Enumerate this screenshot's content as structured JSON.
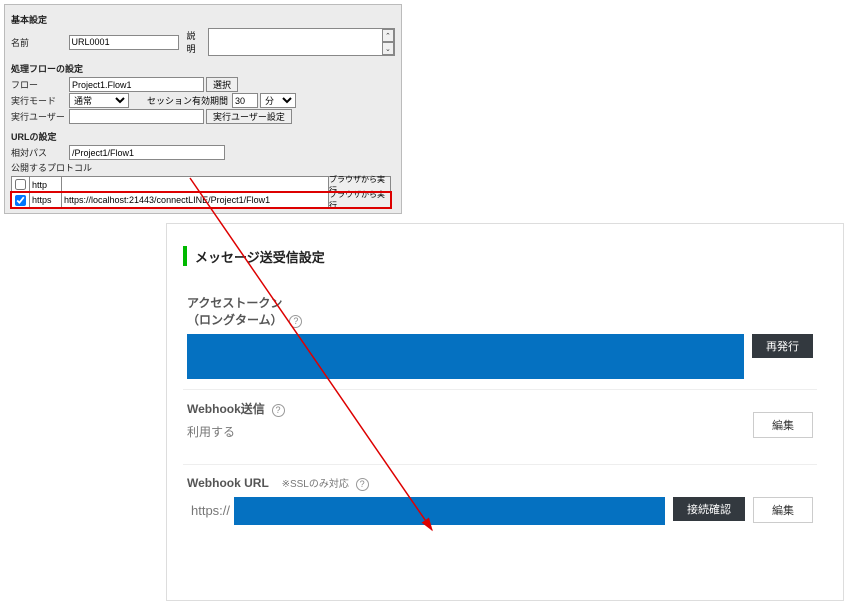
{
  "dialog": {
    "sect_basic": "基本設定",
    "label_name": "名前",
    "name_value": "URL0001",
    "label_desc": "説明",
    "sect_flow": "処理フローの設定",
    "label_flow": "フロー",
    "flow_value": "Project1.Flow1",
    "btn_select": "選択",
    "label_mode": "実行モード",
    "mode_value": "通常",
    "label_session": "セッション有効期間",
    "session_value": "30",
    "session_unit": "分",
    "label_exec_user": "実行ユーザー",
    "btn_exec_user": "実行ユーザー設定",
    "sect_url": "URLの設定",
    "label_relpath": "相対パス",
    "relpath_value": "/Project1/Flow1",
    "label_proto": "公開するプロトコル",
    "rows": [
      {
        "checked": false,
        "proto": "http",
        "url": "",
        "btn": "ブラウザから実行"
      },
      {
        "checked": true,
        "proto": "https",
        "url": "https://localhost:21443/connectLINE/Project1/Flow1",
        "btn": "ブラウザから実行"
      }
    ]
  },
  "card": {
    "heading": "メッセージ送受信設定",
    "token_title": "アクセストークン",
    "token_sub": "（ロングターム）",
    "btn_reissue": "再発行",
    "webhook_send_title": "Webhook送信",
    "webhook_send_status": "利用する",
    "btn_edit": "編集",
    "webhook_url_title": "Webhook URL",
    "ssl_note": "※SSLのみ対応",
    "url_prefix": "https://",
    "btn_verify": "接続確認"
  }
}
